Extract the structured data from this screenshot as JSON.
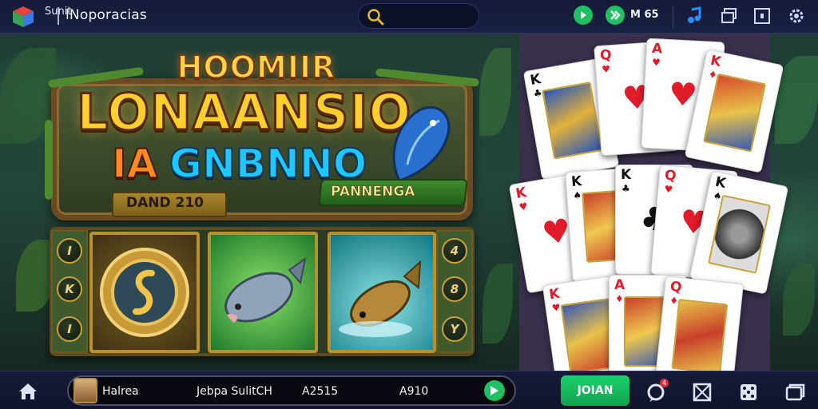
{
  "topbar": {
    "app_title": "lNoporacias",
    "search_label": "Sunit",
    "action_label": "M 65",
    "icons": [
      "cube-app-icon",
      "search-icon",
      "play-icon",
      "double-chevron-icon",
      "music-icon",
      "copy-icon",
      "window-icon",
      "gear-icon"
    ]
  },
  "hero": {
    "title_top": "HOOMIIR",
    "title_main": "LONAANSIO",
    "title_sub_a": "IA",
    "title_sub_b": "GNBNNO",
    "banner_left": "DAND 210",
    "banner_right": "PANNENGA"
  },
  "slot": {
    "left_buttons": [
      "I",
      "K",
      "I"
    ],
    "right_buttons": [
      "4",
      "8",
      "Y"
    ],
    "reels": [
      "coin-symbol",
      "fish-symbol",
      "splash-fish-symbol"
    ]
  },
  "cards": [
    {
      "rank": "K",
      "suit": "♣",
      "color": "black",
      "kind": "face"
    },
    {
      "rank": "Q",
      "suit": "♥",
      "color": "red",
      "kind": "pip"
    },
    {
      "rank": "A",
      "suit": "♥",
      "color": "red",
      "kind": "pip"
    },
    {
      "rank": "K",
      "suit": "♦",
      "color": "red",
      "kind": "face"
    },
    {
      "rank": "K",
      "suit": "♥",
      "color": "red",
      "kind": "pip"
    },
    {
      "rank": "K",
      "suit": "♠",
      "color": "black",
      "kind": "face"
    },
    {
      "rank": "K",
      "suit": "♣",
      "color": "black",
      "kind": "pip"
    },
    {
      "rank": "Q",
      "suit": "♥",
      "color": "red",
      "kind": "pip"
    },
    {
      "rank": "K",
      "suit": "♠",
      "color": "black",
      "kind": "face"
    },
    {
      "rank": "K",
      "suit": "♥",
      "color": "red",
      "kind": "face"
    },
    {
      "rank": "A",
      "suit": "♦",
      "color": "red",
      "kind": "face"
    },
    {
      "rank": "Q",
      "suit": "♦",
      "color": "red",
      "kind": "face"
    }
  ],
  "bottombar": {
    "player_name": "Halrea",
    "field_1": "Jebpa SulitCH",
    "field_2": "A2515",
    "field_3": "A910",
    "action_button": "JOIAN",
    "notification_count": "4"
  },
  "colors": {
    "accent_green": "#1fbf62",
    "topbar_bg": "#141a36",
    "card_red": "#e21b2b",
    "cards_panel_bg": "#3a2f4c"
  }
}
